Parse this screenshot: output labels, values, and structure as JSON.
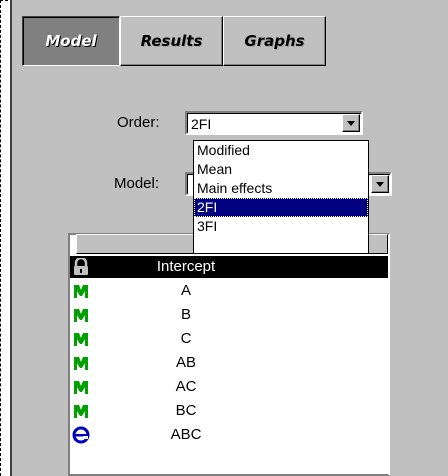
{
  "tabs": [
    {
      "label": "Model",
      "active": true
    },
    {
      "label": "Results",
      "active": false
    },
    {
      "label": "Graphs",
      "active": false
    }
  ],
  "order": {
    "label": "Order:",
    "value": "2FI"
  },
  "model": {
    "label": "Model:",
    "value": ""
  },
  "order_options": [
    "Modified",
    "Mean",
    "Main effects",
    "2FI",
    "3FI"
  ],
  "order_selected": "2FI",
  "terms": [
    {
      "label": "Intercept",
      "icon": "lock-icon",
      "highlighted": true
    },
    {
      "label": "A",
      "icon": "model-term-icon"
    },
    {
      "label": "B",
      "icon": "model-term-icon"
    },
    {
      "label": "C",
      "icon": "model-term-icon"
    },
    {
      "label": "AB",
      "icon": "model-term-icon"
    },
    {
      "label": "AC",
      "icon": "model-term-icon"
    },
    {
      "label": "BC",
      "icon": "model-term-icon"
    },
    {
      "label": "ABC",
      "icon": "error-term-icon"
    }
  ],
  "colors": {
    "panel": "#c0c0c0",
    "selection": "#000080",
    "model_icon": "#00a000",
    "error_icon": "#0000c0"
  }
}
